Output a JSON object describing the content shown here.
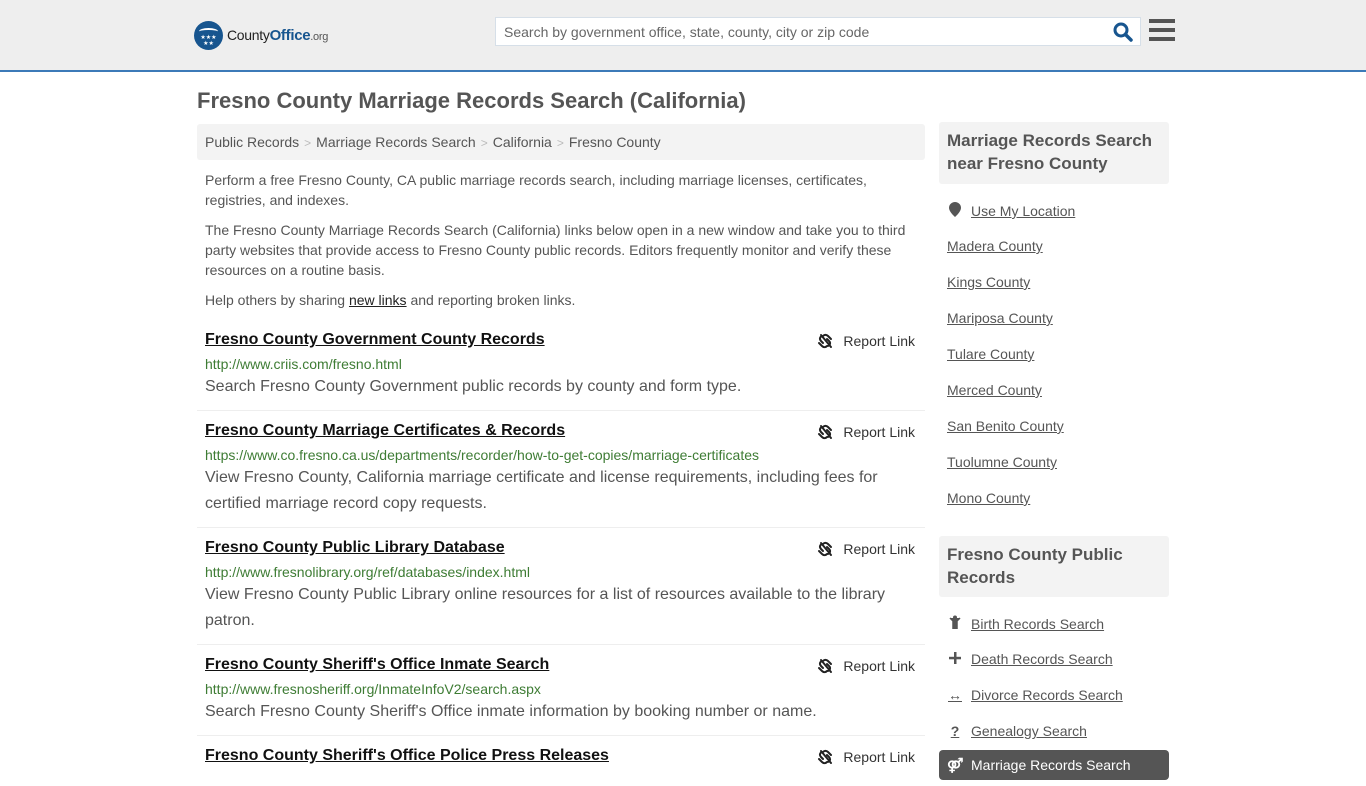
{
  "header": {
    "logo": {
      "name_prefix": "County",
      "name_brand": "Office",
      "name_suffix": ".org"
    },
    "search": {
      "placeholder": "Search by government office, state, county, city or zip code",
      "value": ""
    },
    "colors": {
      "brand": "#17558f",
      "accent_border": "#3c7ab8"
    }
  },
  "page": {
    "title": "Fresno County Marriage Records Search (California)"
  },
  "breadcrumb": [
    {
      "label": "Public Records"
    },
    {
      "label": "Marriage Records Search"
    },
    {
      "label": "California"
    },
    {
      "label": "Fresno County"
    }
  ],
  "breadcrumb_separator": ">",
  "intro": {
    "p1": "Perform a free Fresno County, CA public marriage records search, including marriage licenses, certificates, registries, and indexes.",
    "p2": "The Fresno County Marriage Records Search (California) links below open in a new window and take you to third party websites that provide access to Fresno County public records. Editors frequently monitor and verify these resources on a routine basis.",
    "p3_before": "Help others by sharing ",
    "p3_link": "new links",
    "p3_after": " and reporting broken links."
  },
  "results": [
    {
      "title": "Fresno County Government County Records",
      "url": "http://www.criis.com/fresno.html",
      "description": "Search Fresno County Government public records by county and form type.",
      "report_label": "Report Link"
    },
    {
      "title": "Fresno County Marriage Certificates & Records",
      "url": "https://www.co.fresno.ca.us/departments/recorder/how-to-get-copies/marriage-certificates",
      "description": "View Fresno County, California marriage certificate and license requirements, including fees for certified marriage record copy requests.",
      "report_label": "Report Link"
    },
    {
      "title": "Fresno County Public Library Database",
      "url": "http://www.fresnolibrary.org/ref/databases/index.html",
      "description": "View Fresno County Public Library online resources for a list of resources available to the library patron.",
      "report_label": "Report Link"
    },
    {
      "title": "Fresno County Sheriff's Office Inmate Search",
      "url": "http://www.fresnosheriff.org/InmateInfoV2/search.aspx",
      "description": "Search Fresno County Sheriff's Office inmate information by booking number or name.",
      "report_label": "Report Link"
    },
    {
      "title": "Fresno County Sheriff's Office Police Press Releases",
      "url": "",
      "description": "",
      "report_label": "Report Link"
    }
  ],
  "sidebar": {
    "nearby": {
      "heading": "Marriage Records Search near Fresno County",
      "use_location": "Use My Location",
      "counties": [
        "Madera County",
        "Kings County",
        "Mariposa County",
        "Tulare County",
        "Merced County",
        "San Benito County",
        "Tuolumne County",
        "Mono County"
      ]
    },
    "public_records": {
      "heading": "Fresno County Public Records",
      "items": [
        {
          "label": "Birth Records Search",
          "icon": "child-icon"
        },
        {
          "label": "Death Records Search",
          "icon": "cross-icon"
        },
        {
          "label": "Divorce Records Search",
          "icon": "arrows-horizontal-icon"
        },
        {
          "label": "Genealogy Search",
          "icon": "question-icon"
        },
        {
          "label": "Marriage Records Search",
          "icon": "marriage-icon",
          "active": true
        }
      ]
    }
  }
}
